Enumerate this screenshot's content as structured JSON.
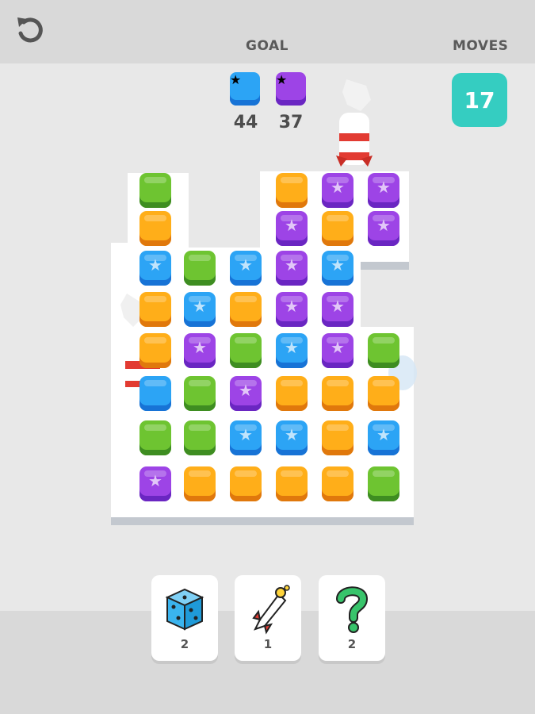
{
  "header": {
    "goal_label": "GOAL",
    "moves_label": "MOVES",
    "moves_value": "17",
    "undo_icon": "undo-arrow-icon"
  },
  "goals": [
    {
      "color": "#2ca4f5",
      "count": "44",
      "name": "blue-star"
    },
    {
      "color": "#9d44e6",
      "count": "37",
      "name": "purple-star"
    }
  ],
  "colors": {
    "green": "#6ec431",
    "orange": "#ffae19",
    "blue": "#2ca4f5",
    "purple": "#9d44e6",
    "moves_badge": "#35cdc1"
  },
  "board": {
    "rows": [
      [
        "green",
        null,
        null,
        "orange",
        "purple*",
        "purple*"
      ],
      [
        "orange",
        null,
        null,
        "purple*",
        "orange",
        "purple*"
      ],
      [
        "blue*",
        "green",
        "blue*",
        "purple*",
        "blue*",
        null
      ],
      [
        "orange",
        "blue*",
        "orange",
        "purple*",
        "purple*",
        null
      ],
      [
        "orange",
        "purple*",
        "green",
        "blue*",
        "purple*",
        "green"
      ],
      [
        "blue",
        "green",
        "purple*",
        "orange",
        "orange",
        "orange"
      ],
      [
        "green",
        "green",
        "blue*",
        "blue*",
        "orange",
        "blue*"
      ],
      [
        "purple*",
        "orange",
        "orange",
        "orange",
        "orange",
        "green"
      ]
    ]
  },
  "powerups": [
    {
      "name": "dice",
      "icon": "dice-icon",
      "count": "2"
    },
    {
      "name": "rocket",
      "icon": "rocket-icon",
      "count": "1"
    },
    {
      "name": "hint",
      "icon": "question-mark-icon",
      "count": "2"
    }
  ]
}
